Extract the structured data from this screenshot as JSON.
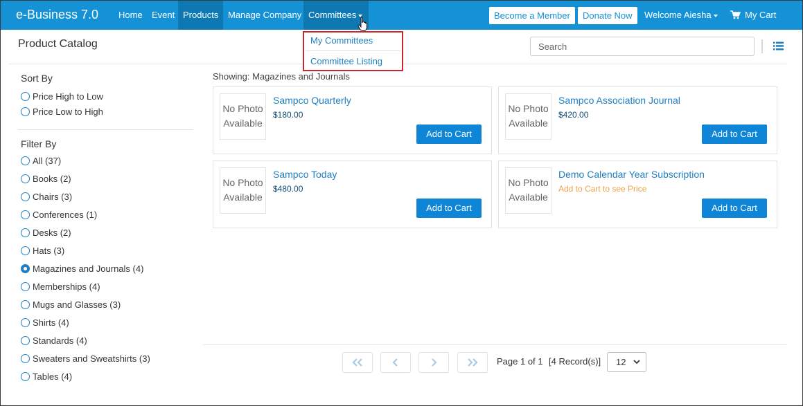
{
  "navbar": {
    "brand": "e-Business 7.0",
    "links": [
      {
        "label": "Home"
      },
      {
        "label": "Event"
      },
      {
        "label": "Products"
      },
      {
        "label": "Manage Company"
      },
      {
        "label": "Committees"
      }
    ],
    "become_member": "Become a Member",
    "donate_now": "Donate Now",
    "welcome": "Welcome Aiesha",
    "my_cart": "My Cart",
    "accent_color": "#1592d6"
  },
  "committees_menu": {
    "items": [
      "My Committees",
      "Committee Listing"
    ]
  },
  "header": {
    "title": "Product Catalog",
    "search_placeholder": "Search"
  },
  "sidebar": {
    "sort_heading": "Sort By",
    "sort_options": [
      "Price High to Low",
      "Price Low to High"
    ],
    "filter_heading": "Filter By",
    "filter_options": [
      {
        "label": "All (37)",
        "checked": false
      },
      {
        "label": "Books (2)",
        "checked": false
      },
      {
        "label": "Chairs (3)",
        "checked": false
      },
      {
        "label": "Conferences (1)",
        "checked": false
      },
      {
        "label": "Desks (2)",
        "checked": false
      },
      {
        "label": "Hats (3)",
        "checked": false
      },
      {
        "label": "Magazines and Journals (4)",
        "checked": true
      },
      {
        "label": "Memberships (4)",
        "checked": false
      },
      {
        "label": "Mugs and Glasses (3)",
        "checked": false
      },
      {
        "label": "Shirts (4)",
        "checked": false
      },
      {
        "label": "Standards (4)",
        "checked": false
      },
      {
        "label": "Sweaters and Sweatshirts (3)",
        "checked": false
      },
      {
        "label": "Tables (4)",
        "checked": false
      }
    ]
  },
  "main": {
    "showing": "Showing: Magazines and Journals",
    "no_photo": "No Photo Available",
    "add_to_cart": "Add to Cart",
    "products": [
      {
        "name": "Sampco Quarterly",
        "price": "$180.00"
      },
      {
        "name": "Sampco Association Journal",
        "price": "$420.00"
      },
      {
        "name": "Sampco Today",
        "price": "$480.00"
      },
      {
        "name": "Demo Calendar Year Subscription",
        "price": "Add to Cart to see Price"
      }
    ]
  },
  "pagination": {
    "page_info": "Page 1 of 1",
    "records": "[4 Record(s)]",
    "page_size": "12"
  }
}
